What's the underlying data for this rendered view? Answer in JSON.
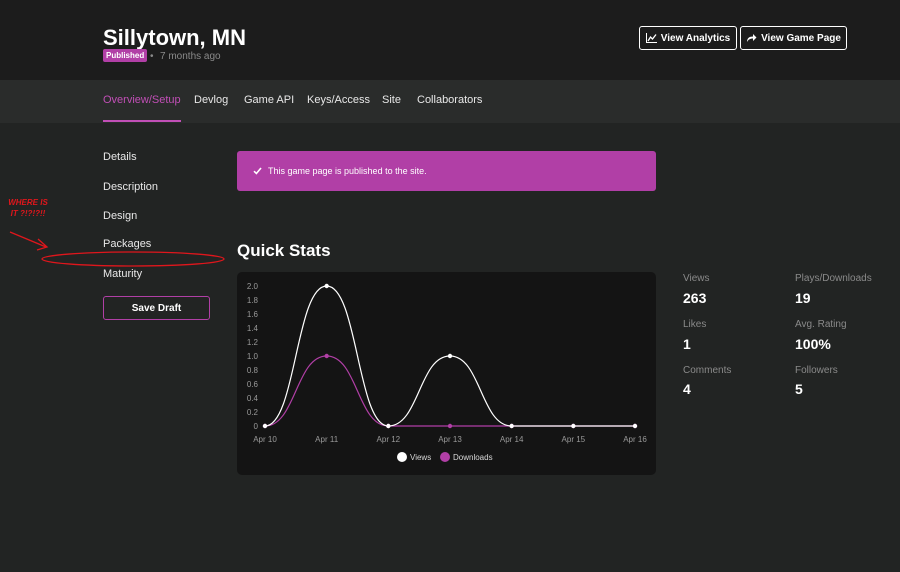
{
  "header": {
    "title": "Sillytown, MN",
    "badge": "Published",
    "separator": "•",
    "time_ago": "7 months ago",
    "view_analytics": "View Analytics",
    "view_game_page": "View Game Page"
  },
  "tabs": [
    {
      "label": "Overview/Setup",
      "active": true
    },
    {
      "label": "Devlog"
    },
    {
      "label": "Game API"
    },
    {
      "label": "Keys/Access"
    },
    {
      "label": "Site"
    },
    {
      "label": "Collaborators"
    }
  ],
  "sidebar": {
    "items": [
      "Details",
      "Description",
      "Design",
      "Packages",
      "Maturity"
    ],
    "save_draft": "Save Draft"
  },
  "annotation": {
    "line1": "WHERE IS",
    "line2": "IT ?!?!?!!"
  },
  "notice": {
    "icon": "checkmark-icon",
    "text": "This game page is published to the site."
  },
  "quick_stats": {
    "title": "Quick Stats",
    "stats": [
      {
        "label": "Views",
        "value": "263"
      },
      {
        "label": "Plays/Downloads",
        "value": "19"
      },
      {
        "label": "Likes",
        "value": "1"
      },
      {
        "label": "Avg. Rating",
        "value": "100%"
      },
      {
        "label": "Comments",
        "value": "4"
      },
      {
        "label": "Followers",
        "value": "5"
      }
    ]
  },
  "colors": {
    "accent": "#b13fa6",
    "views_line": "#ffffff",
    "downloads_line": "#b13fa6",
    "annotation": "#e0161c"
  },
  "chart_data": {
    "type": "line",
    "categories": [
      "Apr 10",
      "Apr 11",
      "Apr 12",
      "Apr 13",
      "Apr 14",
      "Apr 15",
      "Apr 16"
    ],
    "y_ticks": [
      "0",
      "0.2",
      "0.4",
      "0.6",
      "0.8",
      "1.0",
      "1.2",
      "1.4",
      "1.6",
      "1.8",
      "2.0"
    ],
    "ylim": [
      0,
      2
    ],
    "series": [
      {
        "name": "Views",
        "values": [
          0,
          2,
          0,
          1,
          0,
          0,
          0
        ],
        "color": "#ffffff"
      },
      {
        "name": "Downloads",
        "values": [
          0,
          1,
          0,
          0,
          0,
          0,
          0
        ],
        "color": "#b13fa6"
      }
    ],
    "legend": "bottom-center",
    "grid": false
  }
}
